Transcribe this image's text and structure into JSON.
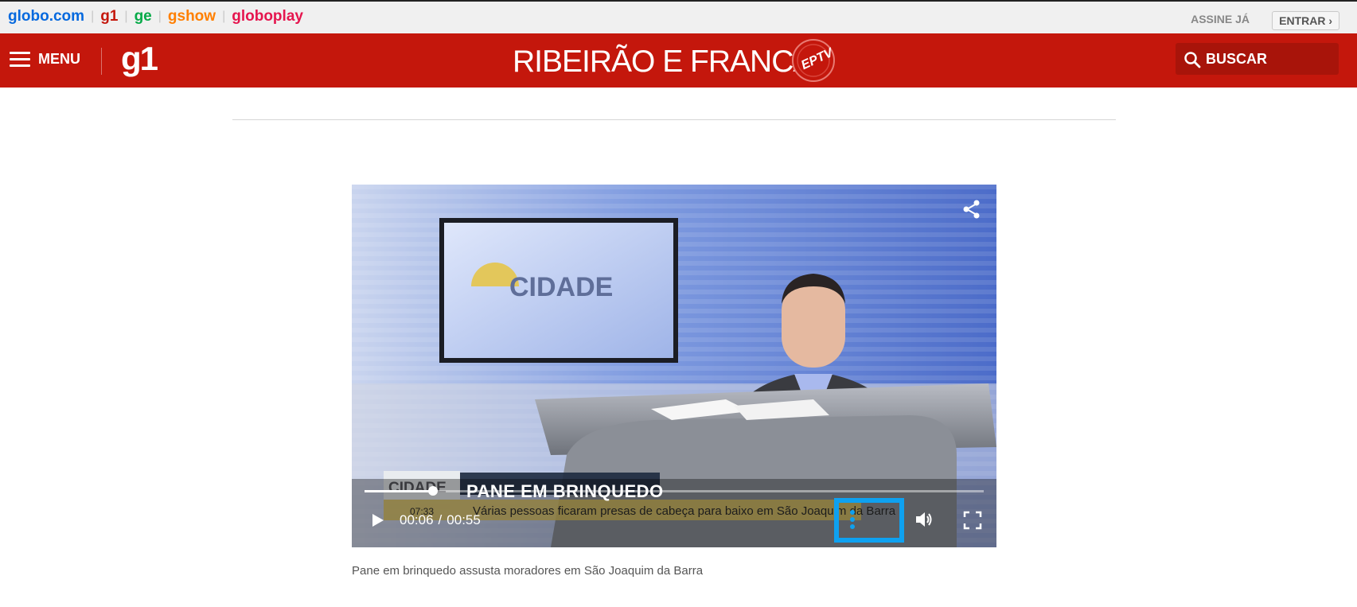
{
  "topbar": {
    "sites": [
      {
        "label": "globo.com",
        "color": "#0669de"
      },
      {
        "label": "g1",
        "color": "#c4170c"
      },
      {
        "label": "ge",
        "color": "#06aa48"
      },
      {
        "label": "gshow",
        "color": "#ff7f00"
      },
      {
        "label": "globoplay",
        "color": "#e5154e"
      }
    ],
    "assine": "ASSINE JÁ",
    "entrar": "ENTRAR ›"
  },
  "header": {
    "menu_label": "MENU",
    "logo": "g1",
    "region_title": "RIBEIRÃO E FRANCA",
    "affiliate_logo": "EPTV",
    "search_label": "BUSCAR",
    "brand_color": "#c4170c"
  },
  "video": {
    "scene": {
      "screen_text": "CIDADE",
      "lower_third_logo": "CIDADE",
      "lower_third_clock": "07:33",
      "lower_third_title": "PANE EM BRINQUEDO",
      "lower_third_subtitle": "Várias pessoas ficaram presas de cabeça para baixo  em São Joaquim da Barra"
    },
    "current_time": "00:06",
    "time_separator": "/",
    "duration": "00:55",
    "progress_fraction": 0.11,
    "highlight_color": "#0ea1f0"
  },
  "caption": "Pane em brinquedo assusta moradores em São Joaquim da Barra"
}
